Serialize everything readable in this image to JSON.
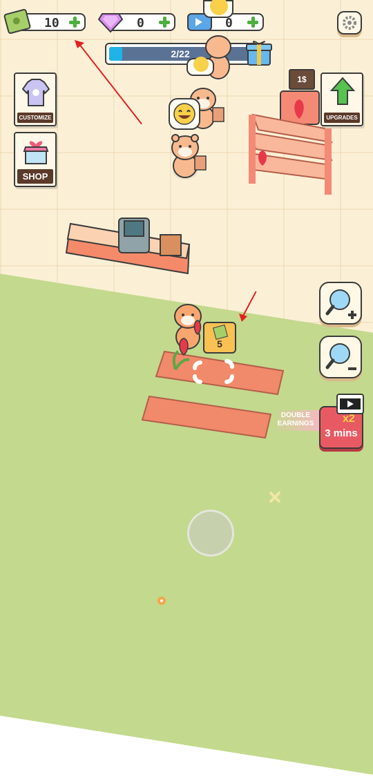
{
  "hud": {
    "cash": "10",
    "gems": "0",
    "tickets": "0",
    "progress_label": "2/22",
    "progress": 0.09
  },
  "left_menu": {
    "customize_label": "CUSTOMIZE",
    "shop_label": "SHOP"
  },
  "right_menu": {
    "upgrades_label": "UPGRADES"
  },
  "stand": {
    "price_label": "1$"
  },
  "farm": {
    "earn_amount": "5"
  },
  "boost": {
    "double_label_1": "DOUBLE",
    "double_label_2": "EARNINGS",
    "multiplier": "x2",
    "duration": "3 mins"
  },
  "colors": {
    "accent_green": "#4caf3c",
    "button_red": "#e85a63",
    "progress_blue": "#1fb3e8",
    "label_brown": "#5b3a29"
  }
}
